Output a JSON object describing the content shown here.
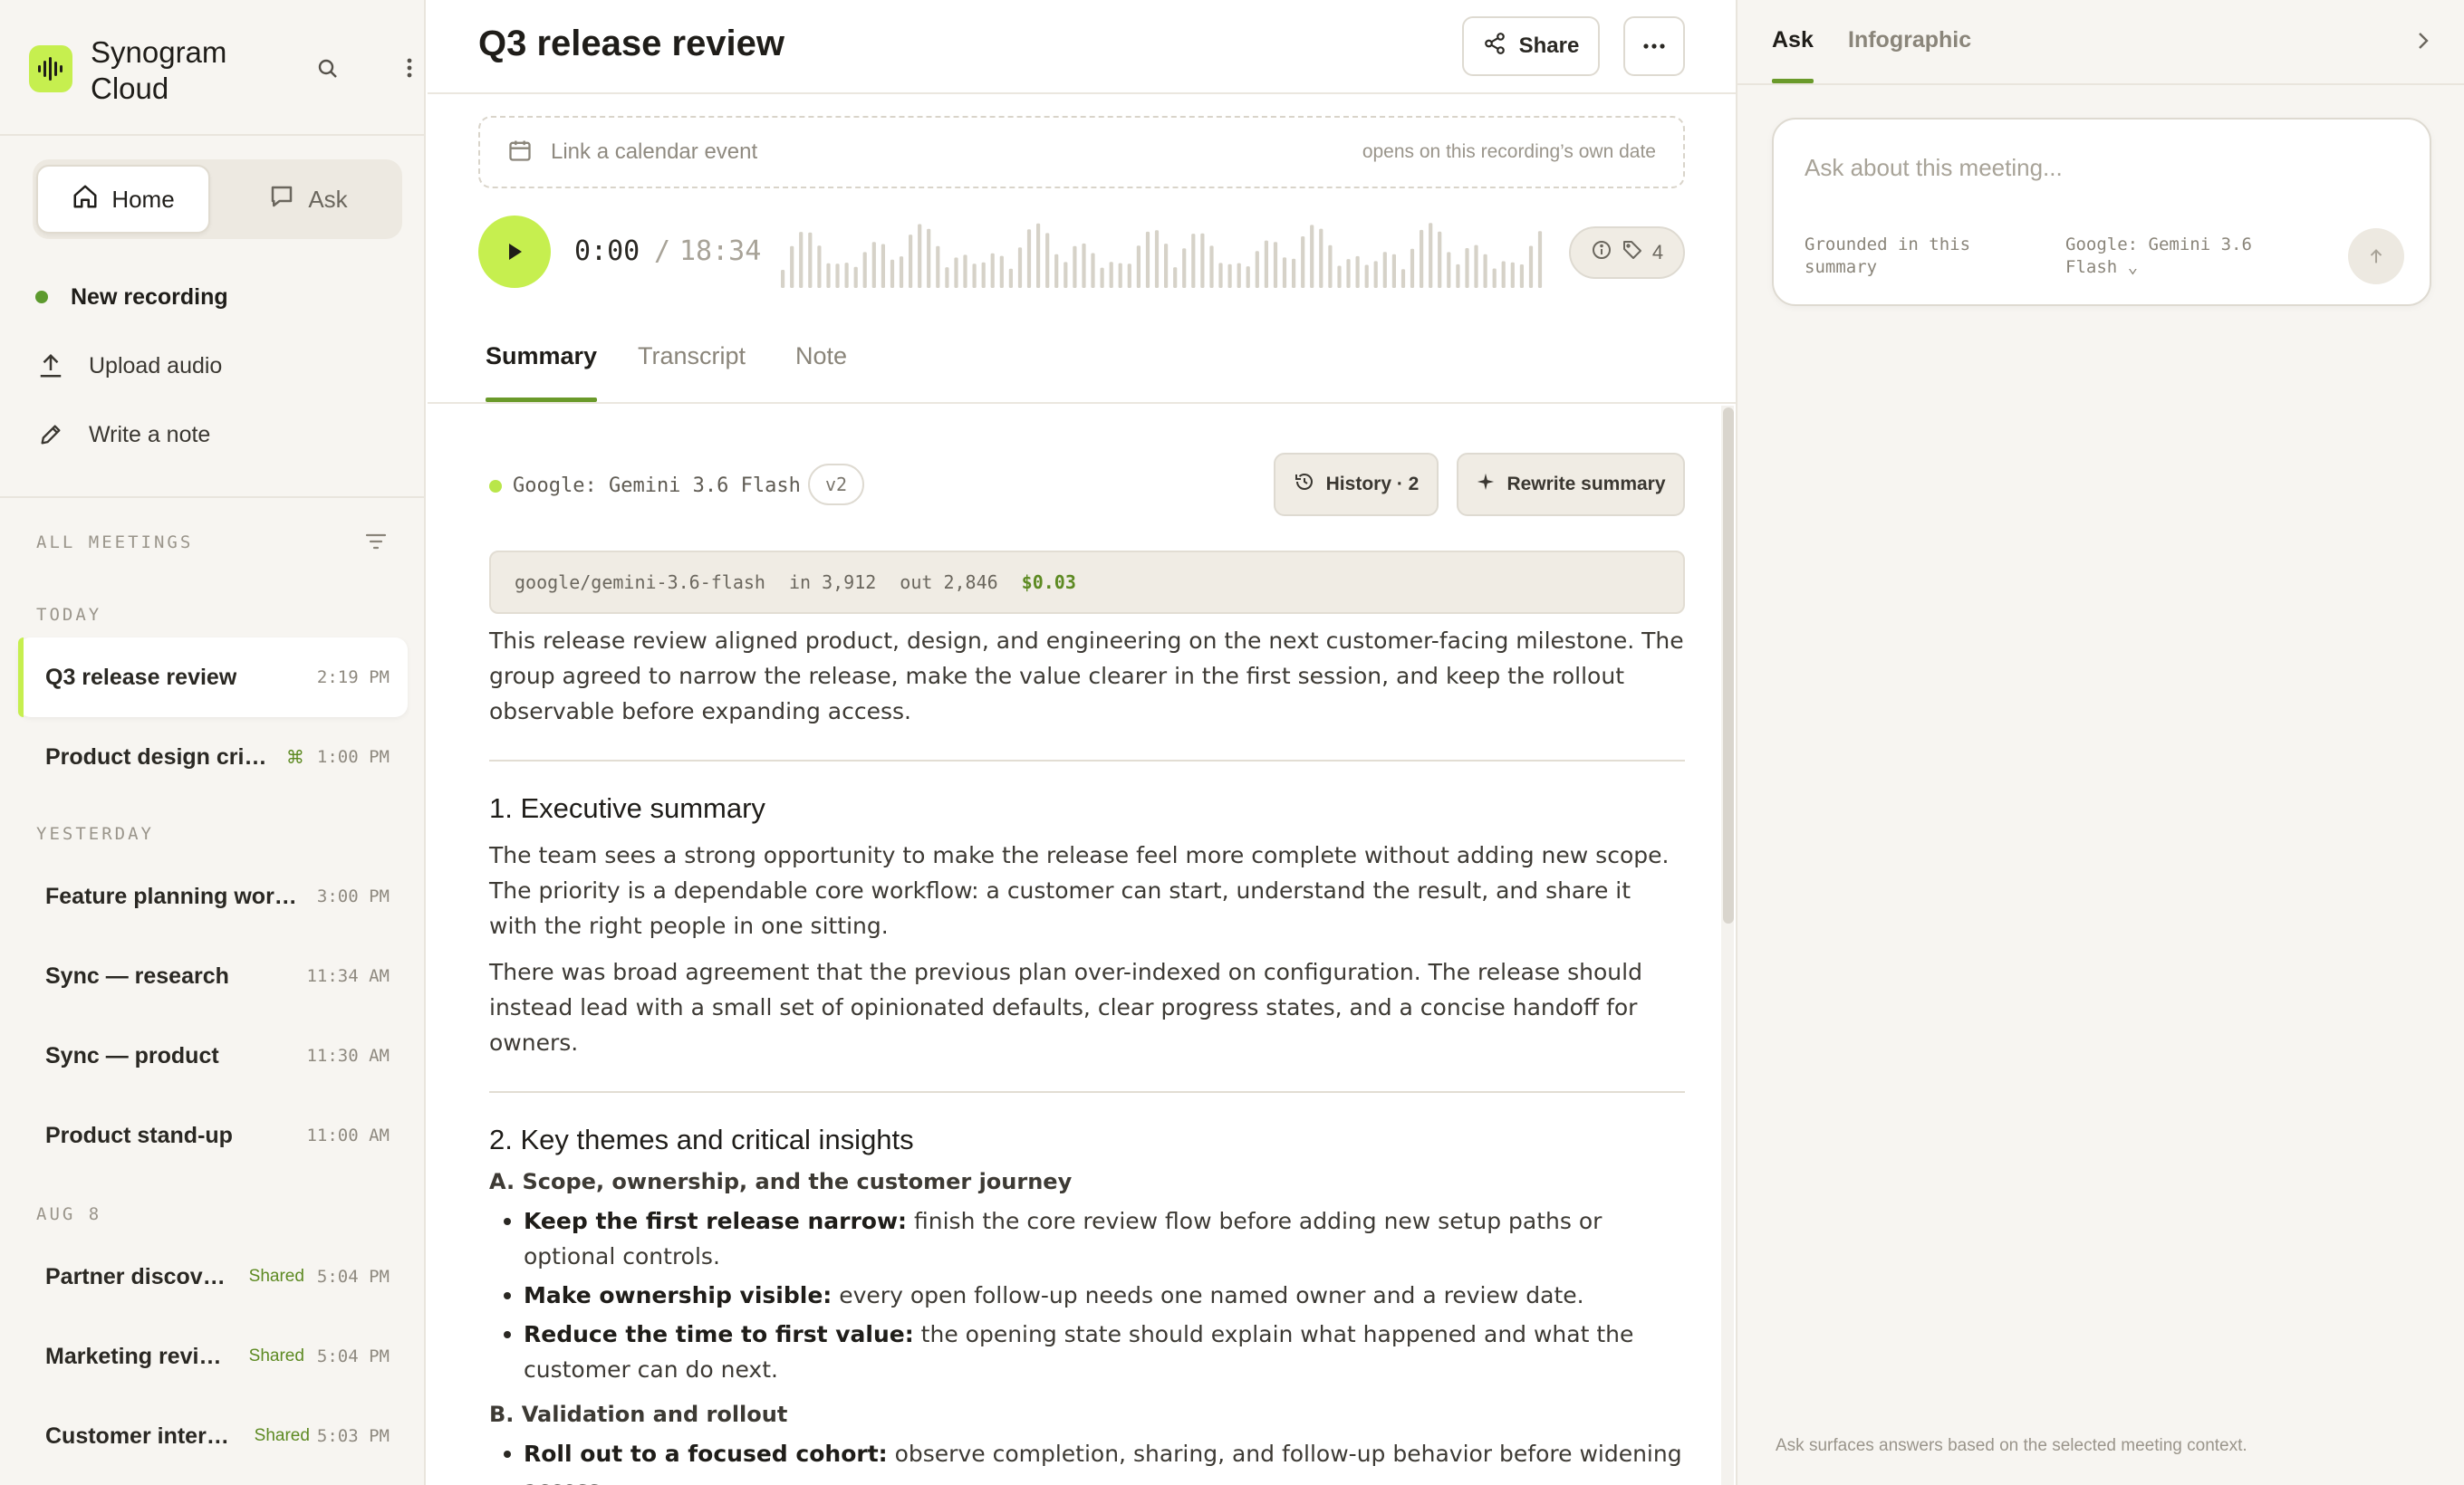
{
  "app": {
    "name": "Synogram Cloud"
  },
  "sidebar": {
    "nav": {
      "home": "Home",
      "ask": "Ask"
    },
    "actions": {
      "new_recording": "New recording",
      "upload_audio": "Upload audio",
      "write_note": "Write a note"
    },
    "all_meetings_label": "ALL MEETINGS",
    "groups": [
      {
        "label": "TODAY",
        "items": [
          {
            "title": "Q3 release review",
            "flag": "",
            "time": "2:19 PM",
            "active": true
          },
          {
            "title": "Product design critique",
            "flag": "⌘",
            "time": "1:00 PM"
          }
        ]
      },
      {
        "label": "YESTERDAY",
        "items": [
          {
            "title": "Feature planning works...",
            "flag": "",
            "time": "3:00 PM"
          },
          {
            "title": "Sync — research",
            "flag": "",
            "time": "11:34 AM"
          },
          {
            "title": "Sync — product",
            "flag": "",
            "time": "11:30 AM"
          },
          {
            "title": "Product stand-up",
            "flag": "",
            "time": "11:00 AM"
          }
        ]
      },
      {
        "label": "AUG 8",
        "items": [
          {
            "title": "Partner discovery",
            "flag": "Shared",
            "time": "5:04 PM"
          },
          {
            "title": "Marketing review",
            "flag": "Shared",
            "time": "5:04 PM"
          },
          {
            "title": "Customer intervi...",
            "flag": "Shared",
            "time": "5:03 PM"
          }
        ]
      }
    ]
  },
  "main": {
    "title": "Q3 release review",
    "share_label": "Share",
    "calendar": {
      "placeholder": "Link a calendar event",
      "hint": "opens on this recording’s own date"
    },
    "player": {
      "current": "0:00",
      "separator": "/",
      "total": "18:34",
      "tag_count": "4",
      "progress": 0
    },
    "tabs": [
      "Summary",
      "Transcript",
      "Note"
    ],
    "active_tab": "Summary",
    "model": {
      "name": "Google: Gemini 3.6 Flash",
      "version": "v2"
    },
    "history_label": "History · 2",
    "rewrite_label": "Rewrite summary",
    "meta": {
      "model_id": "google/gemini-3.6-flash",
      "tokens_in": "in 3,912",
      "tokens_out": "out 2,846",
      "cost": "$0.03"
    },
    "summary": {
      "intro": "This release review aligned product, design, and engineering on the next customer-facing milestone. The group agreed to narrow the release, make the value clearer in the first session, and keep the rollout observable before expanding access.",
      "section1": {
        "heading": "1. Executive summary",
        "p1": "The team sees a strong opportunity to make the release feel more complete without adding new scope. The priority is a dependable core workflow: a customer can start, understand the result, and share it with the right people in one sitting.",
        "p2": "There was broad agreement that the previous plan over-indexed on configuration. The release should instead lead with a small set of opinionated defaults, clear progress states, and a concise handoff for owners."
      },
      "section2": {
        "heading": "2. Key themes and critical insights",
        "subA": "A. Scope, ownership, and the customer journey",
        "bulletsA": [
          {
            "bold": "Keep the first release narrow:",
            "text": " finish the core review flow before adding new setup paths or optional controls."
          },
          {
            "bold": "Make ownership visible:",
            "text": " every open follow-up needs one named owner and a review date."
          },
          {
            "bold": "Reduce the time to first value:",
            "text": " the opening state should explain what happened and what the customer can do next."
          }
        ],
        "subB": "B. Validation and rollout",
        "bulletsB": [
          {
            "bold": "Roll out to a focused cohort:",
            "text": " observe completion, sharing, and follow-up behavior before widening access."
          }
        ]
      }
    }
  },
  "right_panel": {
    "tabs": [
      "Ask",
      "Infographic"
    ],
    "active_tab": "Ask",
    "placeholder": "Ask about this meeting...",
    "grounded": "Grounded in this summary",
    "model": "Google: Gemini 3.6 Flash ⌄",
    "footer": "Ask surfaces answers based on the selected meeting context."
  },
  "colors": {
    "accent": "#c6ef4f",
    "accent_dark": "#6a9a2a",
    "shared": "#5d8a22"
  },
  "icons": [
    "waveform-logo-icon",
    "search-icon",
    "more-vertical-icon",
    "home-icon",
    "chat-icon",
    "upload-icon",
    "pencil-icon",
    "filter-icon",
    "share-icon",
    "more-horizontal-icon",
    "calendar-icon",
    "play-icon",
    "info-icon",
    "tag-icon",
    "history-icon",
    "sparkle-icon",
    "chevron-right-icon",
    "arrow-up-icon"
  ]
}
